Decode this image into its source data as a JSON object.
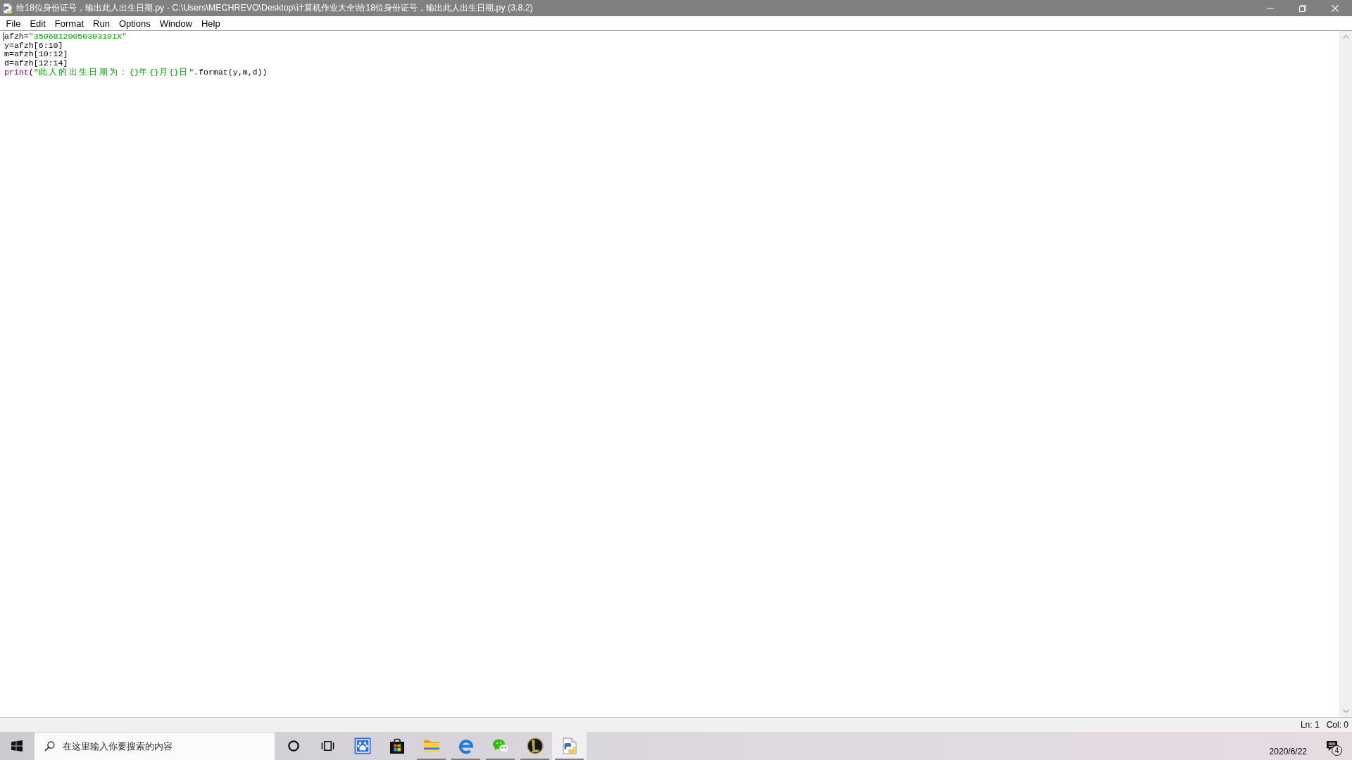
{
  "window": {
    "title": "给18位身份证号，输出此人出生日期.py - C:\\Users\\MECHREVO\\Desktop\\计算机作业大全\\给18位身份证号，输出此人出生日期.py (3.8.2)"
  },
  "menu": [
    {
      "label": "File"
    },
    {
      "label": "Edit"
    },
    {
      "label": "Format"
    },
    {
      "label": "Run"
    },
    {
      "label": "Options"
    },
    {
      "label": "Window"
    },
    {
      "label": "Help"
    }
  ],
  "editor": {
    "lines": [
      {
        "cursor": true,
        "tokens": [
          {
            "kind": "plain",
            "text": "afzh="
          },
          {
            "kind": "string",
            "text": "\"35068120050303101X\""
          }
        ]
      },
      {
        "cursor": false,
        "tokens": [
          {
            "kind": "plain",
            "text": "y=afzh[6:10]"
          }
        ]
      },
      {
        "cursor": false,
        "tokens": [
          {
            "kind": "plain",
            "text": "m=afzh[10:12]"
          }
        ]
      },
      {
        "cursor": false,
        "tokens": [
          {
            "kind": "plain",
            "text": "d=afzh[12:14]"
          }
        ]
      },
      {
        "cursor": false,
        "tokens": [
          {
            "kind": "builtin",
            "text": "print"
          },
          {
            "kind": "plain",
            "text": "("
          },
          {
            "kind": "string",
            "text": "\"此人的出生日期为：{}年{}月{}日\""
          },
          {
            "kind": "plain",
            "text": ".format(y,m,d))"
          }
        ]
      }
    ]
  },
  "status_bar": {
    "line": "Ln: 1",
    "column": "Col: 0"
  },
  "taskbar": {
    "search": {
      "placeholder": "在这里输入你要搜索的内容"
    },
    "apps": [
      {
        "kind": "cortana",
        "running": false,
        "active": false
      },
      {
        "kind": "task_view",
        "running": false,
        "active": false
      },
      {
        "kind": "baidu",
        "running": false,
        "active": false
      },
      {
        "kind": "store",
        "running": false,
        "active": false
      },
      {
        "kind": "explorer",
        "running": true,
        "active": false
      },
      {
        "kind": "edge",
        "running": true,
        "active": false
      },
      {
        "kind": "wechat",
        "running": true,
        "active": false
      },
      {
        "kind": "league",
        "running": true,
        "active": false
      },
      {
        "kind": "python",
        "running": true,
        "active": true
      }
    ],
    "clock": {
      "date": "2020/6/22"
    },
    "notifications": {
      "count": "4"
    }
  }
}
